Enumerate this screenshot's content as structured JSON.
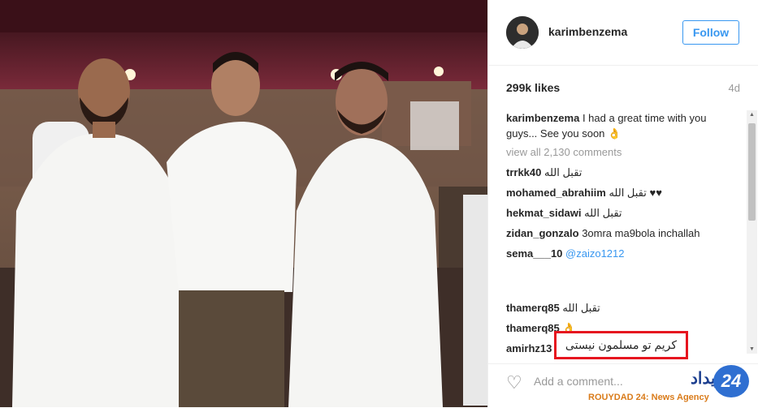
{
  "post": {
    "username": "karimbenzema",
    "follow_label": "Follow",
    "likes": "299k likes",
    "time_ago": "4d",
    "caption_user": "karimbenzema",
    "caption_text": "I had a great time with you guys... See you soon 👌",
    "view_all": "view all 2,130 comments"
  },
  "comments": [
    {
      "user": "trrkk40",
      "text": "تقبل الله"
    },
    {
      "user": "mohamed_abrahiim",
      "text": "تقبل الله ♥♥"
    },
    {
      "user": "hekmat_sidawi",
      "text": "تقبل الله"
    },
    {
      "user": "zidan_gonzalo",
      "text": "3omra ma9bola inchallah"
    },
    {
      "user": "sema___10",
      "text": "@zaizo1212"
    },
    {
      "user": "thamerq85",
      "text": "تقبل الله"
    },
    {
      "user": "thamerq85",
      "text": "👌"
    },
    {
      "user": "amirhz13",
      "text": ""
    }
  ],
  "highlight_comment": "کریم تو مسلمون نیستی",
  "add_comment_placeholder": "Add a comment...",
  "watermark": {
    "badge": "24",
    "persian": "رویداد",
    "agency": "ROUYDAD 24: News Agency"
  },
  "colors": {
    "accent": "#3897f0",
    "highlight_border": "#e6151f"
  }
}
